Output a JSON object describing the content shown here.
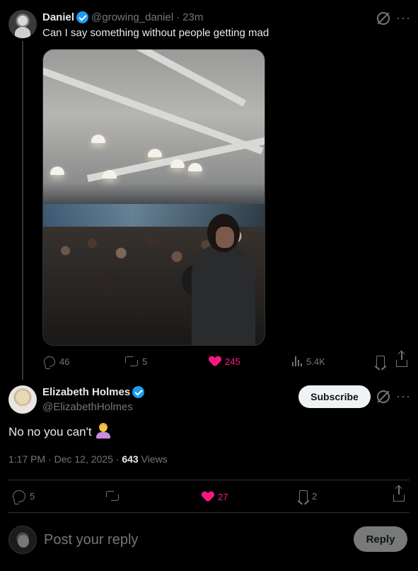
{
  "parent_tweet": {
    "author_name": "Daniel",
    "handle": "@growing_daniel",
    "separator": "·",
    "time_ago": "23m",
    "text": "Can I say something without people getting mad",
    "stats": {
      "replies": "46",
      "reposts": "5",
      "likes": "245",
      "views": "5.4K"
    }
  },
  "main_tweet": {
    "author_name": "Elizabeth Holmes",
    "handle": "@ElizabethHolmes",
    "subscribe_label": "Subscribe",
    "text": "No no you can't",
    "time": "1:17 PM",
    "date": "Dec 12, 2025",
    "dot1": "·",
    "dot2": "·",
    "views_count": "643",
    "views_label": "Views",
    "stats": {
      "replies": "5",
      "reposts": "",
      "likes": "27",
      "bookmarks": "2"
    }
  },
  "composer": {
    "placeholder": "Post your reply",
    "reply_label": "Reply"
  },
  "colors": {
    "background": "#000000",
    "text": "#e7e9ea",
    "muted": "#71767b",
    "like": "#f91880",
    "verified": "#1d9bf0"
  },
  "icons": [
    "grok-icon",
    "more-icon",
    "reply-icon",
    "retweet-icon",
    "heart-icon",
    "views-icon",
    "bookmark-icon",
    "share-icon",
    "verified-badge-icon",
    "person-gesturing-no-emoji"
  ]
}
